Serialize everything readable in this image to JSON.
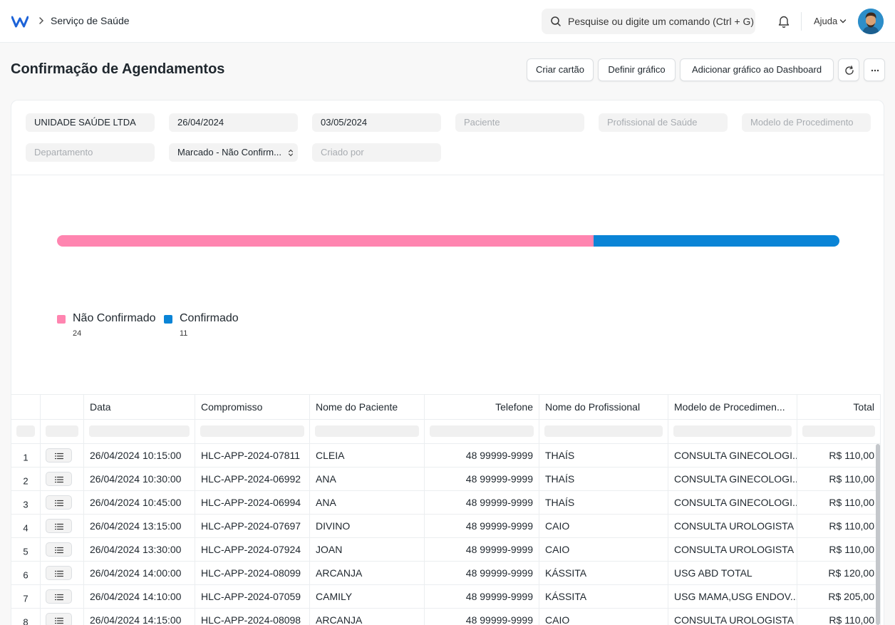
{
  "navbar": {
    "breadcrumb": "Serviço de Saúde",
    "search_placeholder": "Pesquise ou digite um comando (Ctrl + G)",
    "help_label": "Ajuda"
  },
  "page": {
    "title": "Confirmação de Agendamentos",
    "actions": {
      "create_card": "Criar cartão",
      "set_chart": "Definir gráfico",
      "add_to_dashboard": "Adicionar gráfico ao Dashboard"
    }
  },
  "filters": {
    "company": "UNIDADE SAÚDE LTDA",
    "from_date": "26/04/2024",
    "to_date": "03/05/2024",
    "patient_placeholder": "Paciente",
    "practitioner_placeholder": "Profissional de Saúde",
    "procedure_template_placeholder": "Modelo de Procedimento",
    "department_placeholder": "Departamento",
    "status": "Marcado - Não Confirm...",
    "created_by_placeholder": "Criado por"
  },
  "chart_data": {
    "type": "bar",
    "stacked": true,
    "orientation": "horizontal",
    "categories": [
      "Não Confirmado",
      "Confirmado"
    ],
    "values": [
      24,
      11
    ],
    "colors": [
      "#ff85b0",
      "#0a84d6"
    ],
    "legend": "bottom-left"
  },
  "legend": {
    "not_confirmed_label": "Não Confirmado",
    "not_confirmed_value": "24",
    "confirmed_label": "Confirmado",
    "confirmed_value": "11"
  },
  "table": {
    "columns": {
      "date": "Data",
      "appointment": "Compromisso",
      "patient_name": "Nome do Paciente",
      "phone": "Telefone",
      "practitioner_name": "Nome do Profissional",
      "procedure_template": "Modelo de Procedimen...",
      "total": "Total"
    },
    "rows": [
      {
        "n": "1",
        "date": "26/04/2024 10:15:00",
        "appointment": "HLC-APP-2024-07811",
        "patient": "CLEIA",
        "phone": "48 99999-9999",
        "practitioner": "THAÍS",
        "procedure": "CONSULTA GINECOLOGI...",
        "total": "R$ 110,00"
      },
      {
        "n": "2",
        "date": "26/04/2024 10:30:00",
        "appointment": "HLC-APP-2024-06992",
        "patient": "ANA",
        "phone": "48 99999-9999",
        "practitioner": "THAÍS",
        "procedure": "CONSULTA GINECOLOGI...",
        "total": "R$ 110,00"
      },
      {
        "n": "3",
        "date": "26/04/2024 10:45:00",
        "appointment": "HLC-APP-2024-06994",
        "patient": "ANA",
        "phone": "48 99999-9999",
        "practitioner": "THAÍS",
        "procedure": "CONSULTA GINECOLOGI...",
        "total": "R$ 110,00"
      },
      {
        "n": "4",
        "date": "26/04/2024 13:15:00",
        "appointment": "HLC-APP-2024-07697",
        "patient": "DIVINO",
        "phone": "48 99999-9999",
        "practitioner": "CAIO",
        "procedure": "CONSULTA UROLOGISTA",
        "total": "R$ 110,00"
      },
      {
        "n": "5",
        "date": "26/04/2024 13:30:00",
        "appointment": "HLC-APP-2024-07924",
        "patient": "JOAN",
        "phone": "48 99999-9999",
        "practitioner": "CAIO",
        "procedure": "CONSULTA UROLOGISTA",
        "total": "R$ 110,00"
      },
      {
        "n": "6",
        "date": "26/04/2024 14:00:00",
        "appointment": "HLC-APP-2024-08099",
        "patient": "ARCANJA",
        "phone": "48 99999-9999",
        "practitioner": "KÁSSITA",
        "procedure": "USG ABD TOTAL",
        "total": "R$ 120,00"
      },
      {
        "n": "7",
        "date": "26/04/2024 14:10:00",
        "appointment": "HLC-APP-2024-07059",
        "patient": "CAMILY",
        "phone": "48 99999-9999",
        "practitioner": "KÁSSITA",
        "procedure": "USG MAMA,USG ENDOV...",
        "total": "R$ 205,00"
      },
      {
        "n": "8",
        "date": "26/04/2024 14:15:00",
        "appointment": "HLC-APP-2024-08098",
        "patient": "ARCANJA",
        "phone": "48 99999-9999",
        "practitioner": "CAIO",
        "procedure": "CONSULTA UROLOGISTA",
        "total": "R$ 110,00"
      }
    ]
  },
  "colors": {
    "not_confirmed": "#ff85b0",
    "confirmed": "#0a84d6"
  }
}
